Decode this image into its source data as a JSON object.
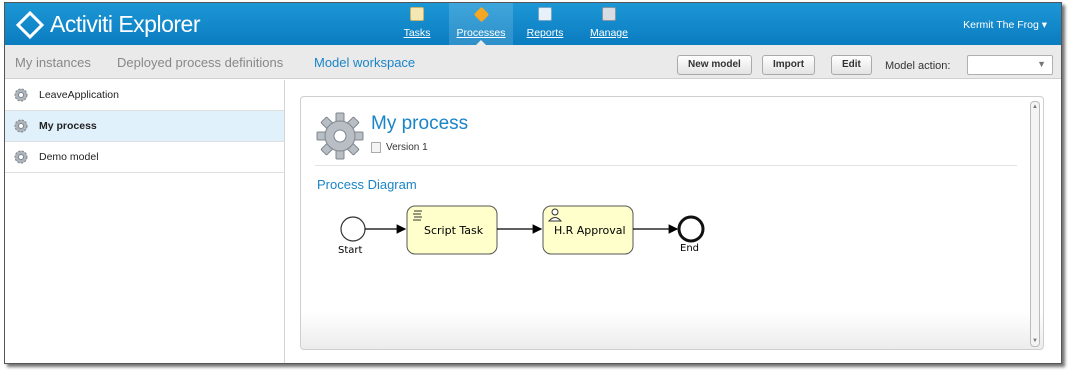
{
  "app": {
    "title": "Activiti Explorer",
    "user": "Kermit The Frog ▾"
  },
  "nav": {
    "items": [
      {
        "label": "Tasks",
        "icon": "tasks-icon"
      },
      {
        "label": "Processes",
        "icon": "processes-icon"
      },
      {
        "label": "Reports",
        "icon": "reports-icon"
      },
      {
        "label": "Manage",
        "icon": "manage-icon"
      }
    ],
    "active": "Processes"
  },
  "subnav": {
    "tabs": [
      "My instances",
      "Deployed process definitions",
      "Model workspace"
    ],
    "active": "Model workspace",
    "buttons": {
      "new_model": "New model",
      "import": "Import",
      "edit": "Edit"
    },
    "model_action_label": "Model action:",
    "model_action_value": ""
  },
  "models": {
    "items": [
      "LeaveApplication",
      "My process",
      "Demo model"
    ],
    "selected": "My process"
  },
  "detail": {
    "title": "My process",
    "version": "Version 1",
    "diagram_title": "Process Diagram",
    "diagram": {
      "start_label": "Start",
      "end_label": "End",
      "task1": "Script Task",
      "task2": "H.R Approval"
    }
  },
  "colors": {
    "header": "#0d84c9",
    "accent": "#1a84c7",
    "task_fill": "#ffffcc",
    "selected_row": "#e1f1fb"
  }
}
